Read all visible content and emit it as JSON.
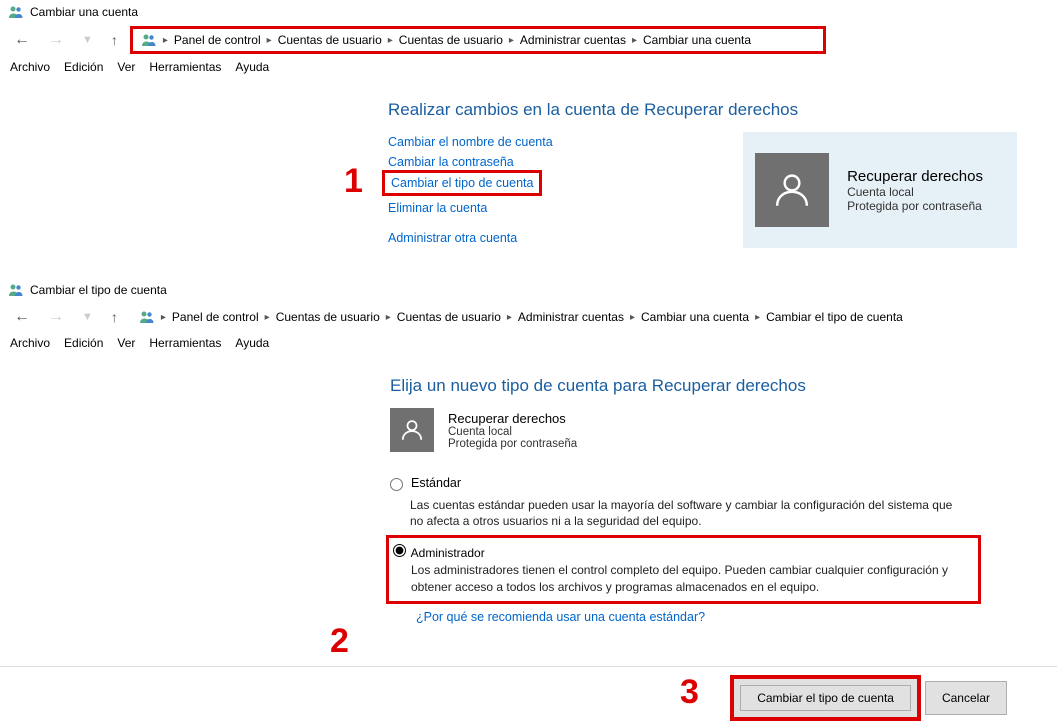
{
  "screen1": {
    "window_title": "Cambiar una cuenta",
    "breadcrumb": [
      "Panel de control",
      "Cuentas de usuario",
      "Cuentas de usuario",
      "Administrar cuentas",
      "Cambiar una cuenta"
    ],
    "menu": {
      "archivo": "Archivo",
      "edicion": "Edición",
      "ver": "Ver",
      "herramientas": "Herramientas",
      "ayuda": "Ayuda"
    },
    "heading": "Realizar cambios en la cuenta de Recuperar derechos",
    "links": {
      "rename": "Cambiar el nombre de cuenta",
      "password": "Cambiar la contraseña",
      "type": "Cambiar el tipo de cuenta",
      "delete": "Eliminar la cuenta",
      "other": "Administrar otra cuenta"
    },
    "account": {
      "name": "Recuperar derechos",
      "kind": "Cuenta local",
      "prot": "Protegida por contraseña"
    },
    "annotation": "1"
  },
  "screen2": {
    "window_title": "Cambiar el tipo de cuenta",
    "breadcrumb": [
      "Panel de control",
      "Cuentas de usuario",
      "Cuentas de usuario",
      "Administrar cuentas",
      "Cambiar una cuenta",
      "Cambiar el tipo de cuenta"
    ],
    "menu": {
      "archivo": "Archivo",
      "edicion": "Edición",
      "ver": "Ver",
      "herramientas": "Herramientas",
      "ayuda": "Ayuda"
    },
    "heading": "Elija un nuevo tipo de cuenta para Recuperar derechos",
    "account": {
      "name": "Recuperar derechos",
      "kind": "Cuenta local",
      "prot": "Protegida por contraseña"
    },
    "standard": {
      "label": "Estándar",
      "desc": "Las cuentas estándar pueden usar la mayoría del software y cambiar la configuración del sistema que no afecta a otros usuarios ni a la seguridad del equipo."
    },
    "admin": {
      "label": "Administrador",
      "desc": "Los administradores tienen el control completo del equipo. Pueden cambiar cualquier configuración y obtener acceso a todos los archivos y programas almacenados en el equipo."
    },
    "why_link": "¿Por qué se recomienda usar una cuenta estándar?",
    "buttons": {
      "change": "Cambiar el tipo de cuenta",
      "cancel": "Cancelar"
    },
    "annotation2": "2",
    "annotation3": "3"
  }
}
